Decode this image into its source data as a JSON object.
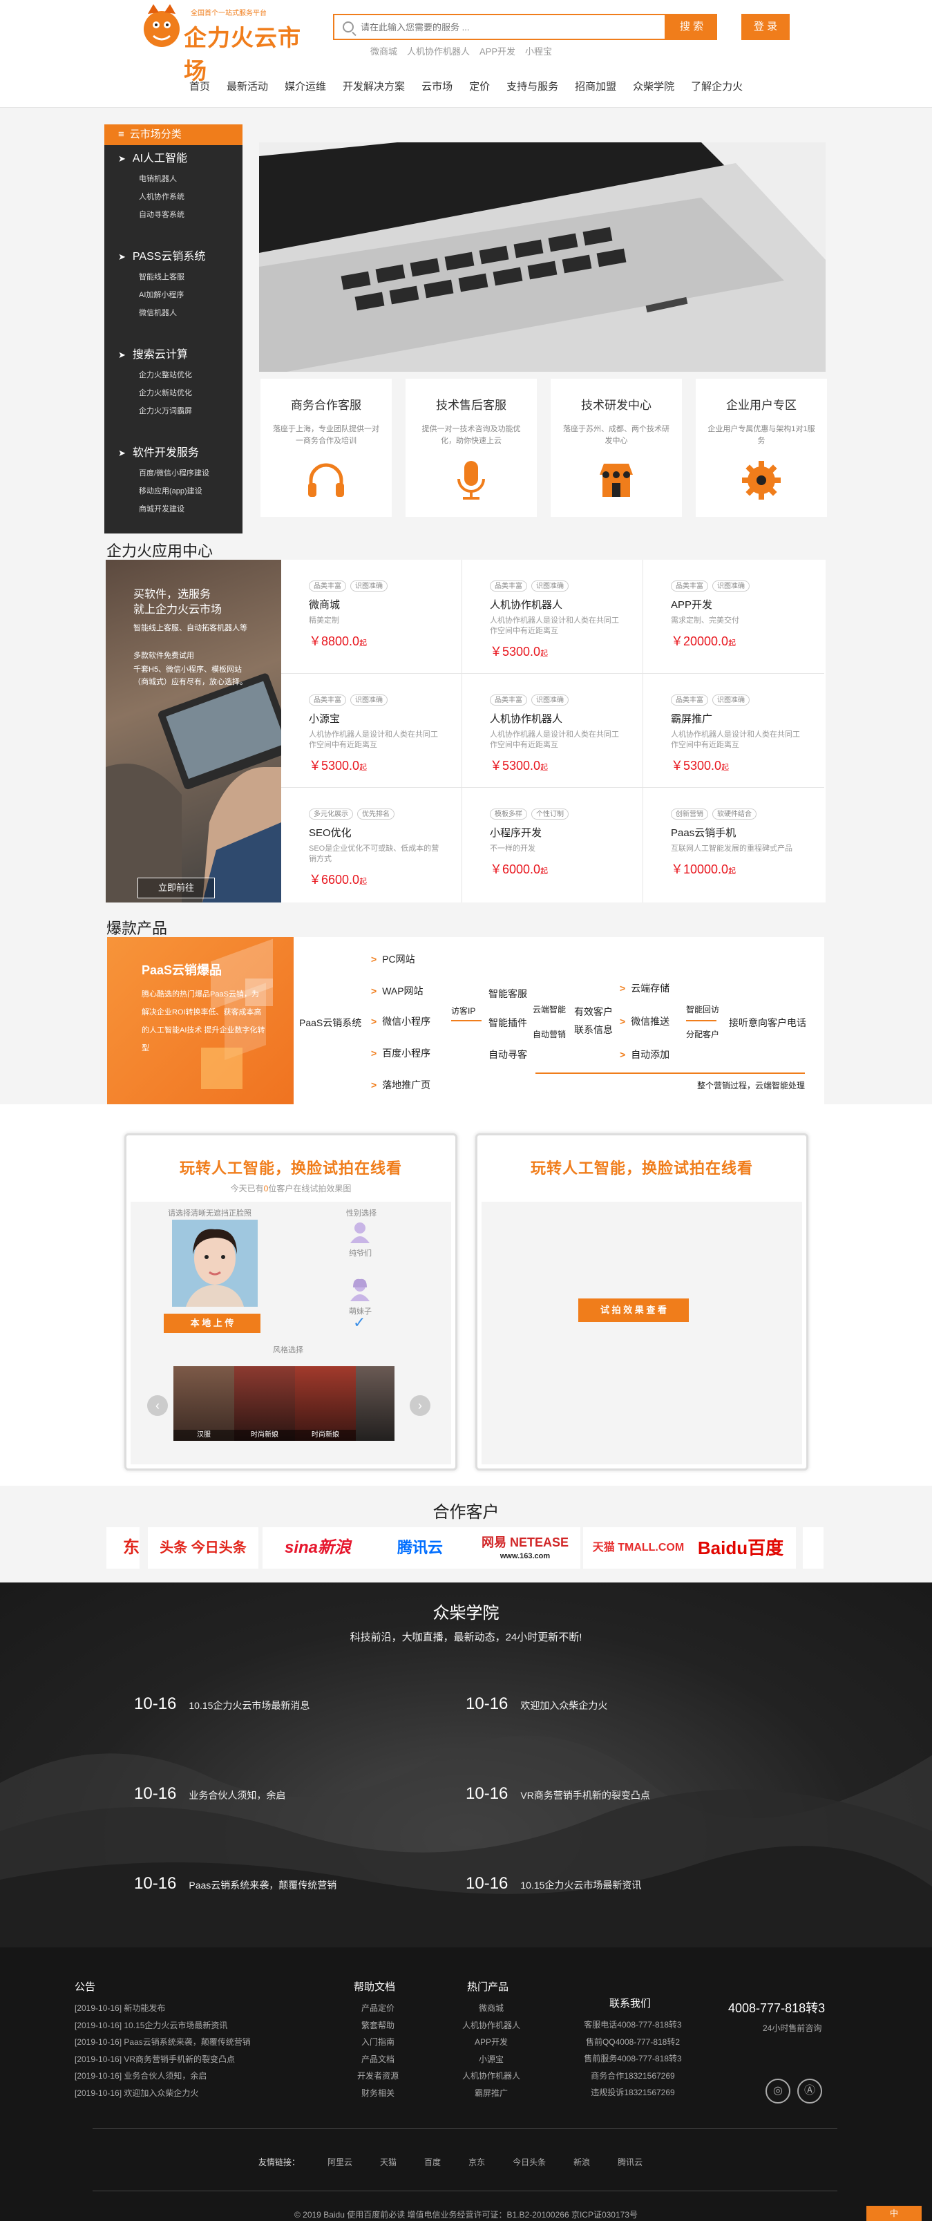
{
  "header": {
    "slogan": "全国首个一站式服务平台",
    "logo_text": "企力火云市场",
    "search_placeholder": "请在此输入您需要的服务 ...",
    "search_btn": "搜 索",
    "login_btn": "登 录",
    "hotwords": [
      "微商城",
      "人机协作机器人",
      "APP开发",
      "小程宝"
    ],
    "nav": [
      "首页",
      "最新活动",
      "媒介运维",
      "开发解决方案",
      "云市场",
      "定价",
      "支持与服务",
      "招商加盟",
      "众柴学院",
      "了解企力火"
    ]
  },
  "categories": {
    "header": "云市场分类",
    "groups": [
      {
        "title": "AI人工智能",
        "items": [
          "电销机器人",
          "人机协作系统",
          "自动寻客系统"
        ]
      },
      {
        "title": "PASS云销系统",
        "items": [
          "智能线上客服",
          "AI加解小程序",
          "微信机器人"
        ]
      },
      {
        "title": "搜索云计算",
        "items": [
          "企力火整站优化",
          "企力火新站优化",
          "企力火万词霸屏"
        ]
      },
      {
        "title": "软件开发服务",
        "items": [
          "百度/微信小程序建设",
          "移动应用(app)建设",
          "商城开发建设"
        ]
      }
    ]
  },
  "services": [
    {
      "title": "商务合作客服",
      "desc": "落座于上海，专业团队提供一对一商务合作及培训",
      "icon": "headphones-icon"
    },
    {
      "title": "技术售后客服",
      "desc": "提供一对一技术咨询及功能优化，助你快速上云",
      "icon": "microphone-icon"
    },
    {
      "title": "技术研发中心",
      "desc": "落座于苏州、成都、两个技术研发中心",
      "icon": "shop-icon"
    },
    {
      "title": "企业用户专区",
      "desc": "企业用户专属优惠与架构1对1服务",
      "icon": "gear-icon"
    }
  ],
  "app_center": {
    "title": "企力火应用中心",
    "promo": {
      "line1": "买软件，选服务",
      "line2": "就上企力火云市场",
      "desc1": "智能线上客服、自动拓客机器人等",
      "desc2": "多款软件免费试用",
      "desc3": "千套H5、微信小程序、模板网站（商城式）应有尽有，放心选择。",
      "btn": "立即前往"
    },
    "apps": [
      {
        "tags": [
          "品类丰富",
          "识图准确"
        ],
        "name": "微商城",
        "desc": "精美定制",
        "price": "￥8800.0",
        "unit": "起"
      },
      {
        "tags": [
          "品类丰富",
          "识图准确"
        ],
        "name": "人机协作机器人",
        "desc": "人机协作机器人是设计和人类在共同工作空间中有近距离互",
        "price": "￥5300.0",
        "unit": "起"
      },
      {
        "tags": [
          "品类丰富",
          "识图准确"
        ],
        "name": "APP开发",
        "desc": "需求定制、完美交付",
        "price": "￥20000.0",
        "unit": "起"
      },
      {
        "tags": [
          "品类丰富",
          "识图准确"
        ],
        "name": "小源宝",
        "desc": "人机协作机器人是设计和人类在共同工作空间中有近距离互",
        "price": "￥5300.0",
        "unit": "起"
      },
      {
        "tags": [
          "品类丰富",
          "识图准确"
        ],
        "name": "人机协作机器人",
        "desc": "人机协作机器人是设计和人类在共同工作空间中有近距离互",
        "price": "￥5300.0",
        "unit": "起"
      },
      {
        "tags": [
          "品类丰富",
          "识图准确"
        ],
        "name": "霸屏推广",
        "desc": "人机协作机器人是设计和人类在共同工作空间中有近距离互",
        "price": "￥5300.0",
        "unit": "起"
      },
      {
        "tags": [
          "多元化展示",
          "优先排名"
        ],
        "name": "SEO优化",
        "desc": "SEO是企业优化不可或缺、低成本的营销方式",
        "price": "￥6600.0",
        "unit": "起"
      },
      {
        "tags": [
          "模板多样",
          "个性订制"
        ],
        "name": "小程序开发",
        "desc": "不一样的开发",
        "price": "￥6000.0",
        "unit": "起"
      },
      {
        "tags": [
          "创新营销",
          "软硬件结合"
        ],
        "name": "Paas云销手机",
        "desc": "互联网人工智能发展的重程碑式产品",
        "price": "￥10000.0",
        "unit": "起"
      }
    ]
  },
  "explosive": {
    "title": "爆款产品",
    "promo_title": "PaaS云销爆品",
    "promo_desc": "腾心酷选的热门爆品PaaS云销，为解决企业ROI转换率低、获客成本高的人工智能AI技术 提升企业数字化转型",
    "flow": {
      "root": "PaaS云销系统",
      "c1": [
        "PC网站",
        "WAP网站",
        "微信小程序",
        "百度小程序",
        "落地推广页"
      ],
      "l1": "访客IP",
      "c2": [
        "智能客服",
        "智能插件",
        "自动寻客"
      ],
      "c3a": "云端智能",
      "c3b": "自动营销",
      "c3": [
        "有效客户",
        "联系信息"
      ],
      "c4": [
        "云端存储",
        "微信推送",
        "自动添加"
      ],
      "c5a": "智能回访",
      "c5b": "分配客户",
      "c6": "接听意向客户电话",
      "bottom": "整个营销过程，云端智能处理"
    }
  },
  "ai": {
    "title": "玩转人工智能，换脸试拍在线看",
    "today_prefix": "今天已有",
    "today_count": "0",
    "today_suffix": "位客户在线试拍效果图",
    "upload_hint": "请选择清晰无遮挡正脸照",
    "upload_btn": "本 地 上 传",
    "gender_title": "性别选择",
    "gender_male": "纯爷们",
    "gender_female": "萌妹子",
    "style_title": "风格选择",
    "styles": [
      "汉服",
      "时尚新娘",
      "时尚新娘",
      ""
    ],
    "right_title": "玩转人工智能，换脸试拍在线看",
    "view_btn": "试 拍 效 果 查 看"
  },
  "partners": {
    "title": "合作客户",
    "logos": [
      "京东",
      "头条 今日头条",
      "sina新浪",
      "腾讯云",
      "网易 NETEASE",
      "天猫 TMALL.COM",
      "Baidu百度"
    ],
    "net163": "www.163.com",
    "jd_left": "东"
  },
  "academy": {
    "title": "众柴学院",
    "subtitle": "科技前沿，大咖直播，最新动态，24小时更新不断!",
    "news": [
      {
        "date": "10-16",
        "title": "10.15企力火云市场最新消息"
      },
      {
        "date": "10-16",
        "title": "欢迎加入众柴企力火"
      },
      {
        "date": "10-16",
        "title": "业务合伙人须知，余启"
      },
      {
        "date": "10-16",
        "title": "VR商务营销手机新的裂变凸点"
      },
      {
        "date": "10-16",
        "title": "Paas云销系统来袭，颠覆传统营销"
      },
      {
        "date": "10-16",
        "title": "10.15企力火云市场最新资讯"
      }
    ]
  },
  "footer": {
    "notice_title": "公告",
    "notices": [
      "[2019-10-16] 新功能发布",
      "[2019-10-16] 10.15企力火云市场最新资讯",
      "[2019-10-16] Paas云销系统来袭，颠覆传统营销",
      "[2019-10-16] VR商务营销手机新的裂变凸点",
      "[2019-10-16] 业务合伙人须知，余启",
      "[2019-10-16] 欢迎加入众柴企力火"
    ],
    "help_title": "帮助文档",
    "help": [
      "产品定价",
      "繁套帮助",
      "入门指南",
      "产品文档",
      "开发者资源",
      "财务相关"
    ],
    "hot_title": "热门产品",
    "hot": [
      "微商城",
      "人机协作机器人",
      "APP开发",
      "小源宝",
      "人机协作机器人",
      "霸屏推广"
    ],
    "contact_title": "联系我们",
    "contacts": [
      "客服电话4008-777-818转3",
      "售前QQ4008-777-818转2",
      "售前服务4008-777-818转3",
      "商务合作18321567269",
      "违规投诉18321567269"
    ],
    "phone": "4008-777-818转3",
    "phone_sub": "24小时售前咨询",
    "links_label": "友情链接：",
    "links": [
      "阿里云",
      "天猫",
      "百度",
      "京东",
      "今日头条",
      "新浪",
      "腾讯云"
    ],
    "copyright": "© 2019 Baidu 使用百度前必读 增值电信业务经营许可证：B1.B2-20100266 京ICP证030173号",
    "corner": "中"
  }
}
